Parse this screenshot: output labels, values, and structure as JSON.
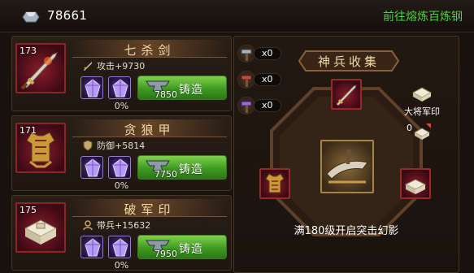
{
  "header": {
    "ingot_icon": "silver-ingot-icon",
    "ingot_count": "78661",
    "goto_link": "前往熔炼百炼钢",
    "link_color": "#4fd13f"
  },
  "weapons": [
    {
      "name": "七杀剑",
      "level": "173",
      "item_icon": "sword-icon",
      "stat_icon": "sword-small-icon",
      "stat": "攻击+9730",
      "gems": [
        "purple-gem-icon",
        "purple-gem-icon"
      ],
      "cost": "7850",
      "button": "铸造",
      "progress": "0%"
    },
    {
      "name": "贪狼甲",
      "level": "171",
      "item_icon": "armor-icon",
      "stat_icon": "shield-small-icon",
      "stat": "防御+5814",
      "gems": [
        "purple-gem-icon",
        "purple-gem-icon"
      ],
      "cost": "7750",
      "button": "铸造",
      "progress": "0%"
    },
    {
      "name": "破军印",
      "level": "175",
      "item_icon": "seal-icon",
      "stat_icon": "soldier-small-icon",
      "stat": "带兵+15632",
      "gems": [
        "purple-gem-icon",
        "purple-gem-icon"
      ],
      "cost": "7950",
      "button": "铸造",
      "progress": "0%"
    }
  ],
  "collection": {
    "title": "神兵收集",
    "tools": [
      {
        "icon": "hammer-icon",
        "count": "x0"
      },
      {
        "icon": "red-hammer-icon",
        "count": "x0"
      },
      {
        "icon": "purple-hammer-icon",
        "count": "x0"
      }
    ],
    "reward_label": "大将军印",
    "reward_count": "0",
    "unlock_text": "满180级开启突击幻影"
  },
  "colors": {
    "forge_button": "#4fae2a",
    "item_frame": "#8c2626",
    "gem_border": "#9a7bd6"
  }
}
